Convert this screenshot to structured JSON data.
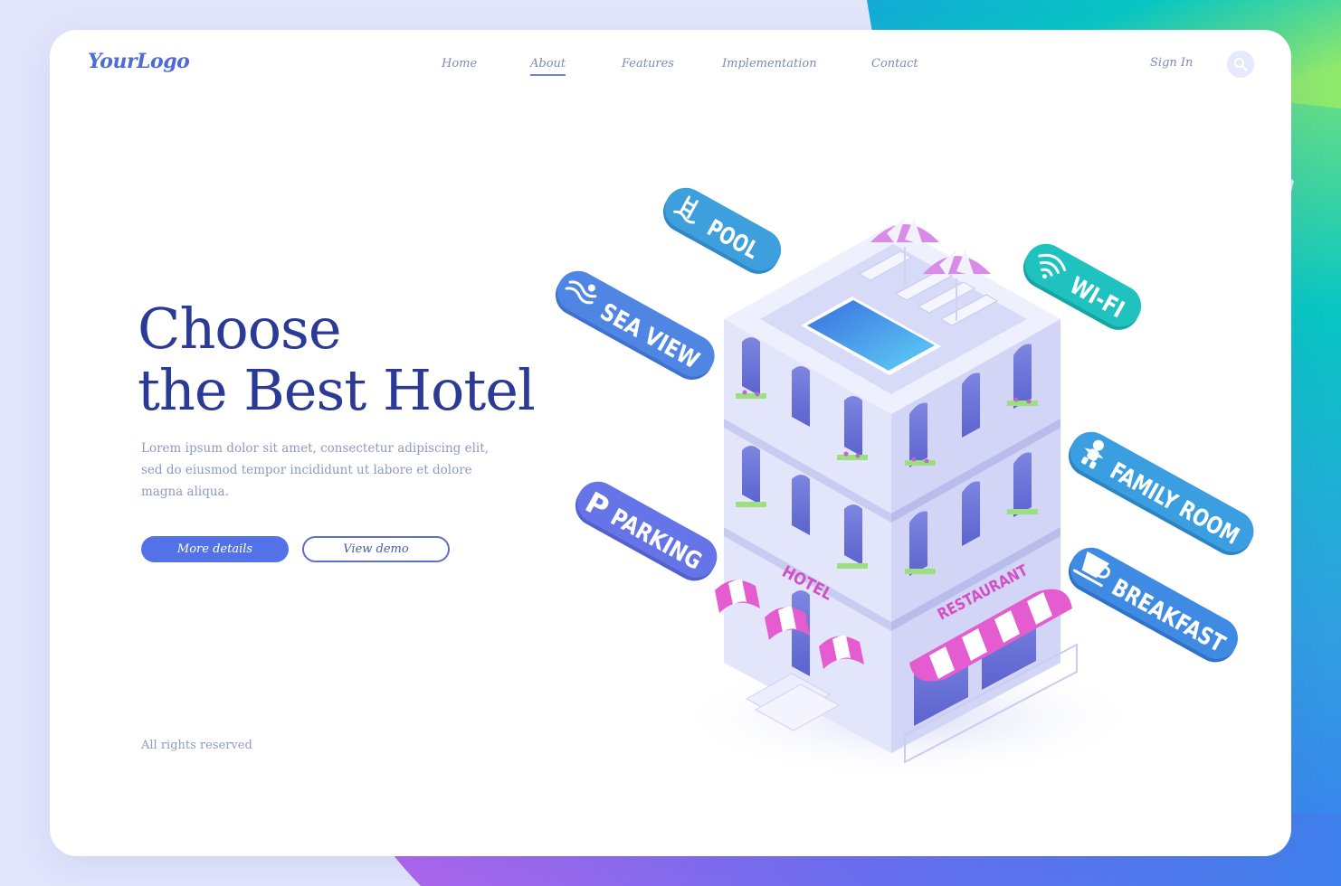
{
  "brand": {
    "logo": "YourLogo"
  },
  "nav": {
    "items": [
      {
        "label": "Home",
        "active": false
      },
      {
        "label": "About",
        "active": true
      },
      {
        "label": "Features",
        "active": false
      },
      {
        "label": "Implementation",
        "active": false
      },
      {
        "label": "Contact",
        "active": false
      }
    ],
    "sign_in": "Sign In",
    "search_icon": "search-icon"
  },
  "hero": {
    "title_line1": "Choose",
    "title_line2": "the Best Hotel",
    "description": "Lorem ipsum dolor sit amet, consectetur adipiscing elit, sed do eiusmod tempor incididunt ut labore et dolore magna aliqua.",
    "primary_button": "More details",
    "secondary_button": "View demo"
  },
  "footer": {
    "text": "All rights reserved"
  },
  "illustration": {
    "building_signs": {
      "hotel": "HOTEL",
      "restaurant": "RESTAURANT"
    },
    "amenity_tags": [
      {
        "label": "POOL",
        "icon": "pool-ladder-icon",
        "color": "#3d9fdc"
      },
      {
        "label": "SEA VIEW",
        "icon": "waves-icon",
        "color": "#4f86e3"
      },
      {
        "label": "WI-FI",
        "icon": "wifi-icon",
        "color": "#1fc2bf"
      },
      {
        "label": "PARKING",
        "icon": "parking-icon",
        "color": "#6574e6"
      },
      {
        "label": "FAMILY ROOM",
        "icon": "baby-icon",
        "color": "#3a9ee0"
      },
      {
        "label": "BREAKFAST",
        "icon": "coffee-cup-icon",
        "color": "#3f8be3"
      }
    ]
  },
  "colors": {
    "accent": "#5472e8",
    "heading": "#2a3a96",
    "body_text": "#8d9bbd",
    "nav_text": "#7a8cb4",
    "awning_pink": "#e45cd0"
  }
}
